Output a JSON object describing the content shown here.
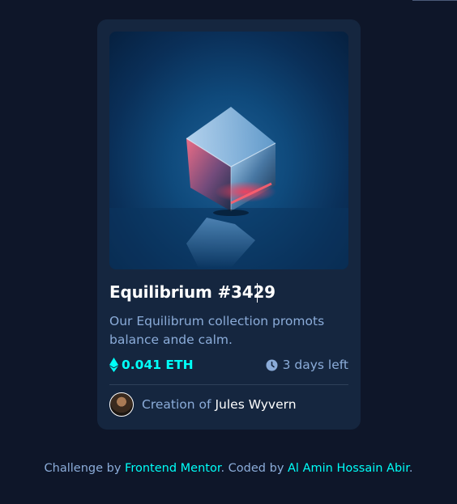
{
  "card": {
    "image": {
      "alt": "Equilibrium",
      "icon": "crystal-cube-image"
    },
    "title": "Equilibrium #3429",
    "description": "Our Equilibrum collection promots balance ande calm.",
    "price": {
      "icon": "ethereum-icon",
      "value": "0.041 ETH"
    },
    "time": {
      "icon": "clock-icon",
      "value": "3 days left"
    },
    "creator": {
      "prefix": "Creation of",
      "name": "Jules Wyvern"
    }
  },
  "footer": {
    "text_1": "Challenge by ",
    "link_1": "Frontend Mentor",
    "text_2": ". Coded by ",
    "link_2": "Al Amin Hossain Abir",
    "text_3": "."
  },
  "colors": {
    "page_bg": "#0e1629",
    "card_bg": "#15263f",
    "accent_cyan": "#00fff8",
    "soft_blue": "#8bacd9",
    "white": "#ffffff"
  }
}
